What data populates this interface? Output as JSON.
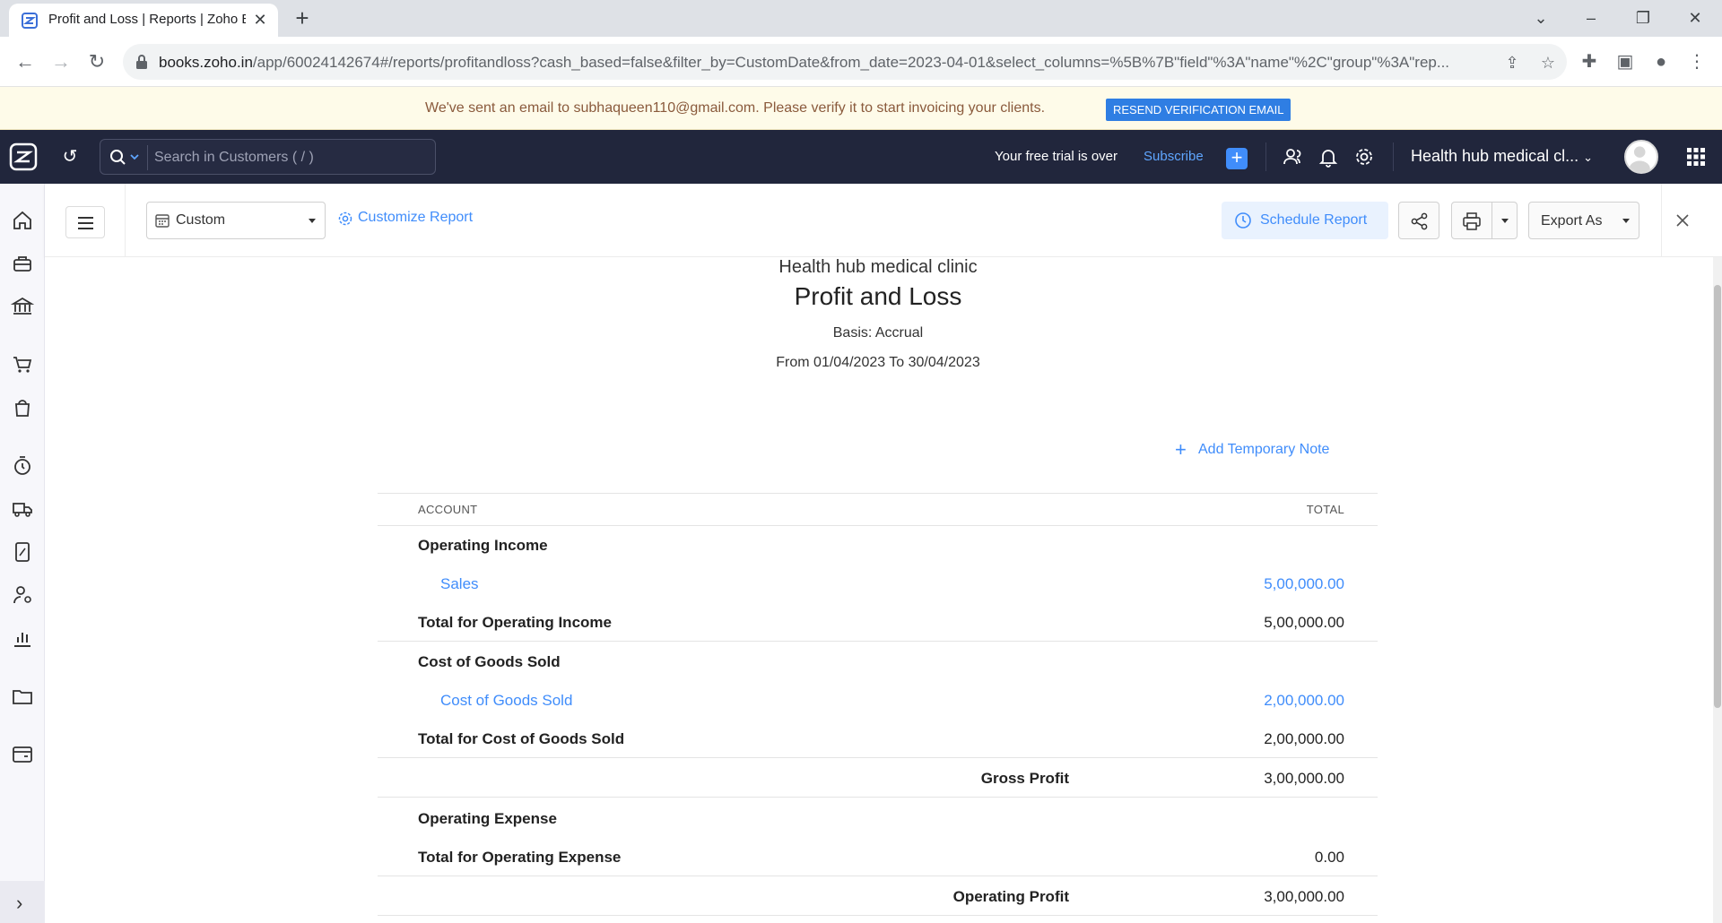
{
  "browser": {
    "tab_title": "Profit and Loss | Reports | Zoho B",
    "url_host": "books.zoho.in",
    "url_path": "/app/60024142674#/reports/profitandloss?cash_based=false&filter_by=CustomDate&from_date=2023-04-01&select_columns=%5B%7B\"field\"%3A\"name\"%2C\"group\"%3A\"rep..."
  },
  "banner": {
    "text": "We've sent an email to subhaqueen110@gmail.com. Please verify it to start invoicing your clients.",
    "button": "RESEND VERIFICATION EMAIL"
  },
  "header": {
    "search_placeholder": "Search in Customers ( / )",
    "trial_text": "Your free trial is over",
    "subscribe_label": "Subscribe",
    "org_name": "Health hub medical cl..."
  },
  "toolbar": {
    "period": "Custom",
    "customize_label": "Customize Report",
    "schedule_label": "Schedule Report",
    "export_label": "Export As"
  },
  "report": {
    "org": "Health hub medical clinic",
    "title": "Profit and Loss",
    "basis": "Basis: Accrual",
    "range": "From 01/04/2023 To 30/04/2023",
    "add_note": "Add Temporary Note",
    "col_account": "ACCOUNT",
    "col_total": "TOTAL",
    "rows": [
      {
        "label": "Operating Income",
        "value": ""
      },
      {
        "label": "Sales",
        "value": "5,00,000.00"
      },
      {
        "label": "Total for Operating Income",
        "value": "5,00,000.00"
      },
      {
        "label": "Cost of Goods Sold",
        "value": ""
      },
      {
        "label": "Cost of Goods Sold",
        "value": "2,00,000.00"
      },
      {
        "label": "Total for Cost of Goods Sold",
        "value": "2,00,000.00"
      },
      {
        "label": "Gross Profit",
        "value": "3,00,000.00"
      },
      {
        "label": "Operating Expense",
        "value": ""
      },
      {
        "label": "Total for Operating Expense",
        "value": "0.00"
      },
      {
        "label": "Operating Profit",
        "value": "3,00,000.00"
      }
    ]
  },
  "colors": {
    "accent": "#408dfb",
    "header_bg": "#21263c",
    "banner_bg": "#fefbe9"
  }
}
